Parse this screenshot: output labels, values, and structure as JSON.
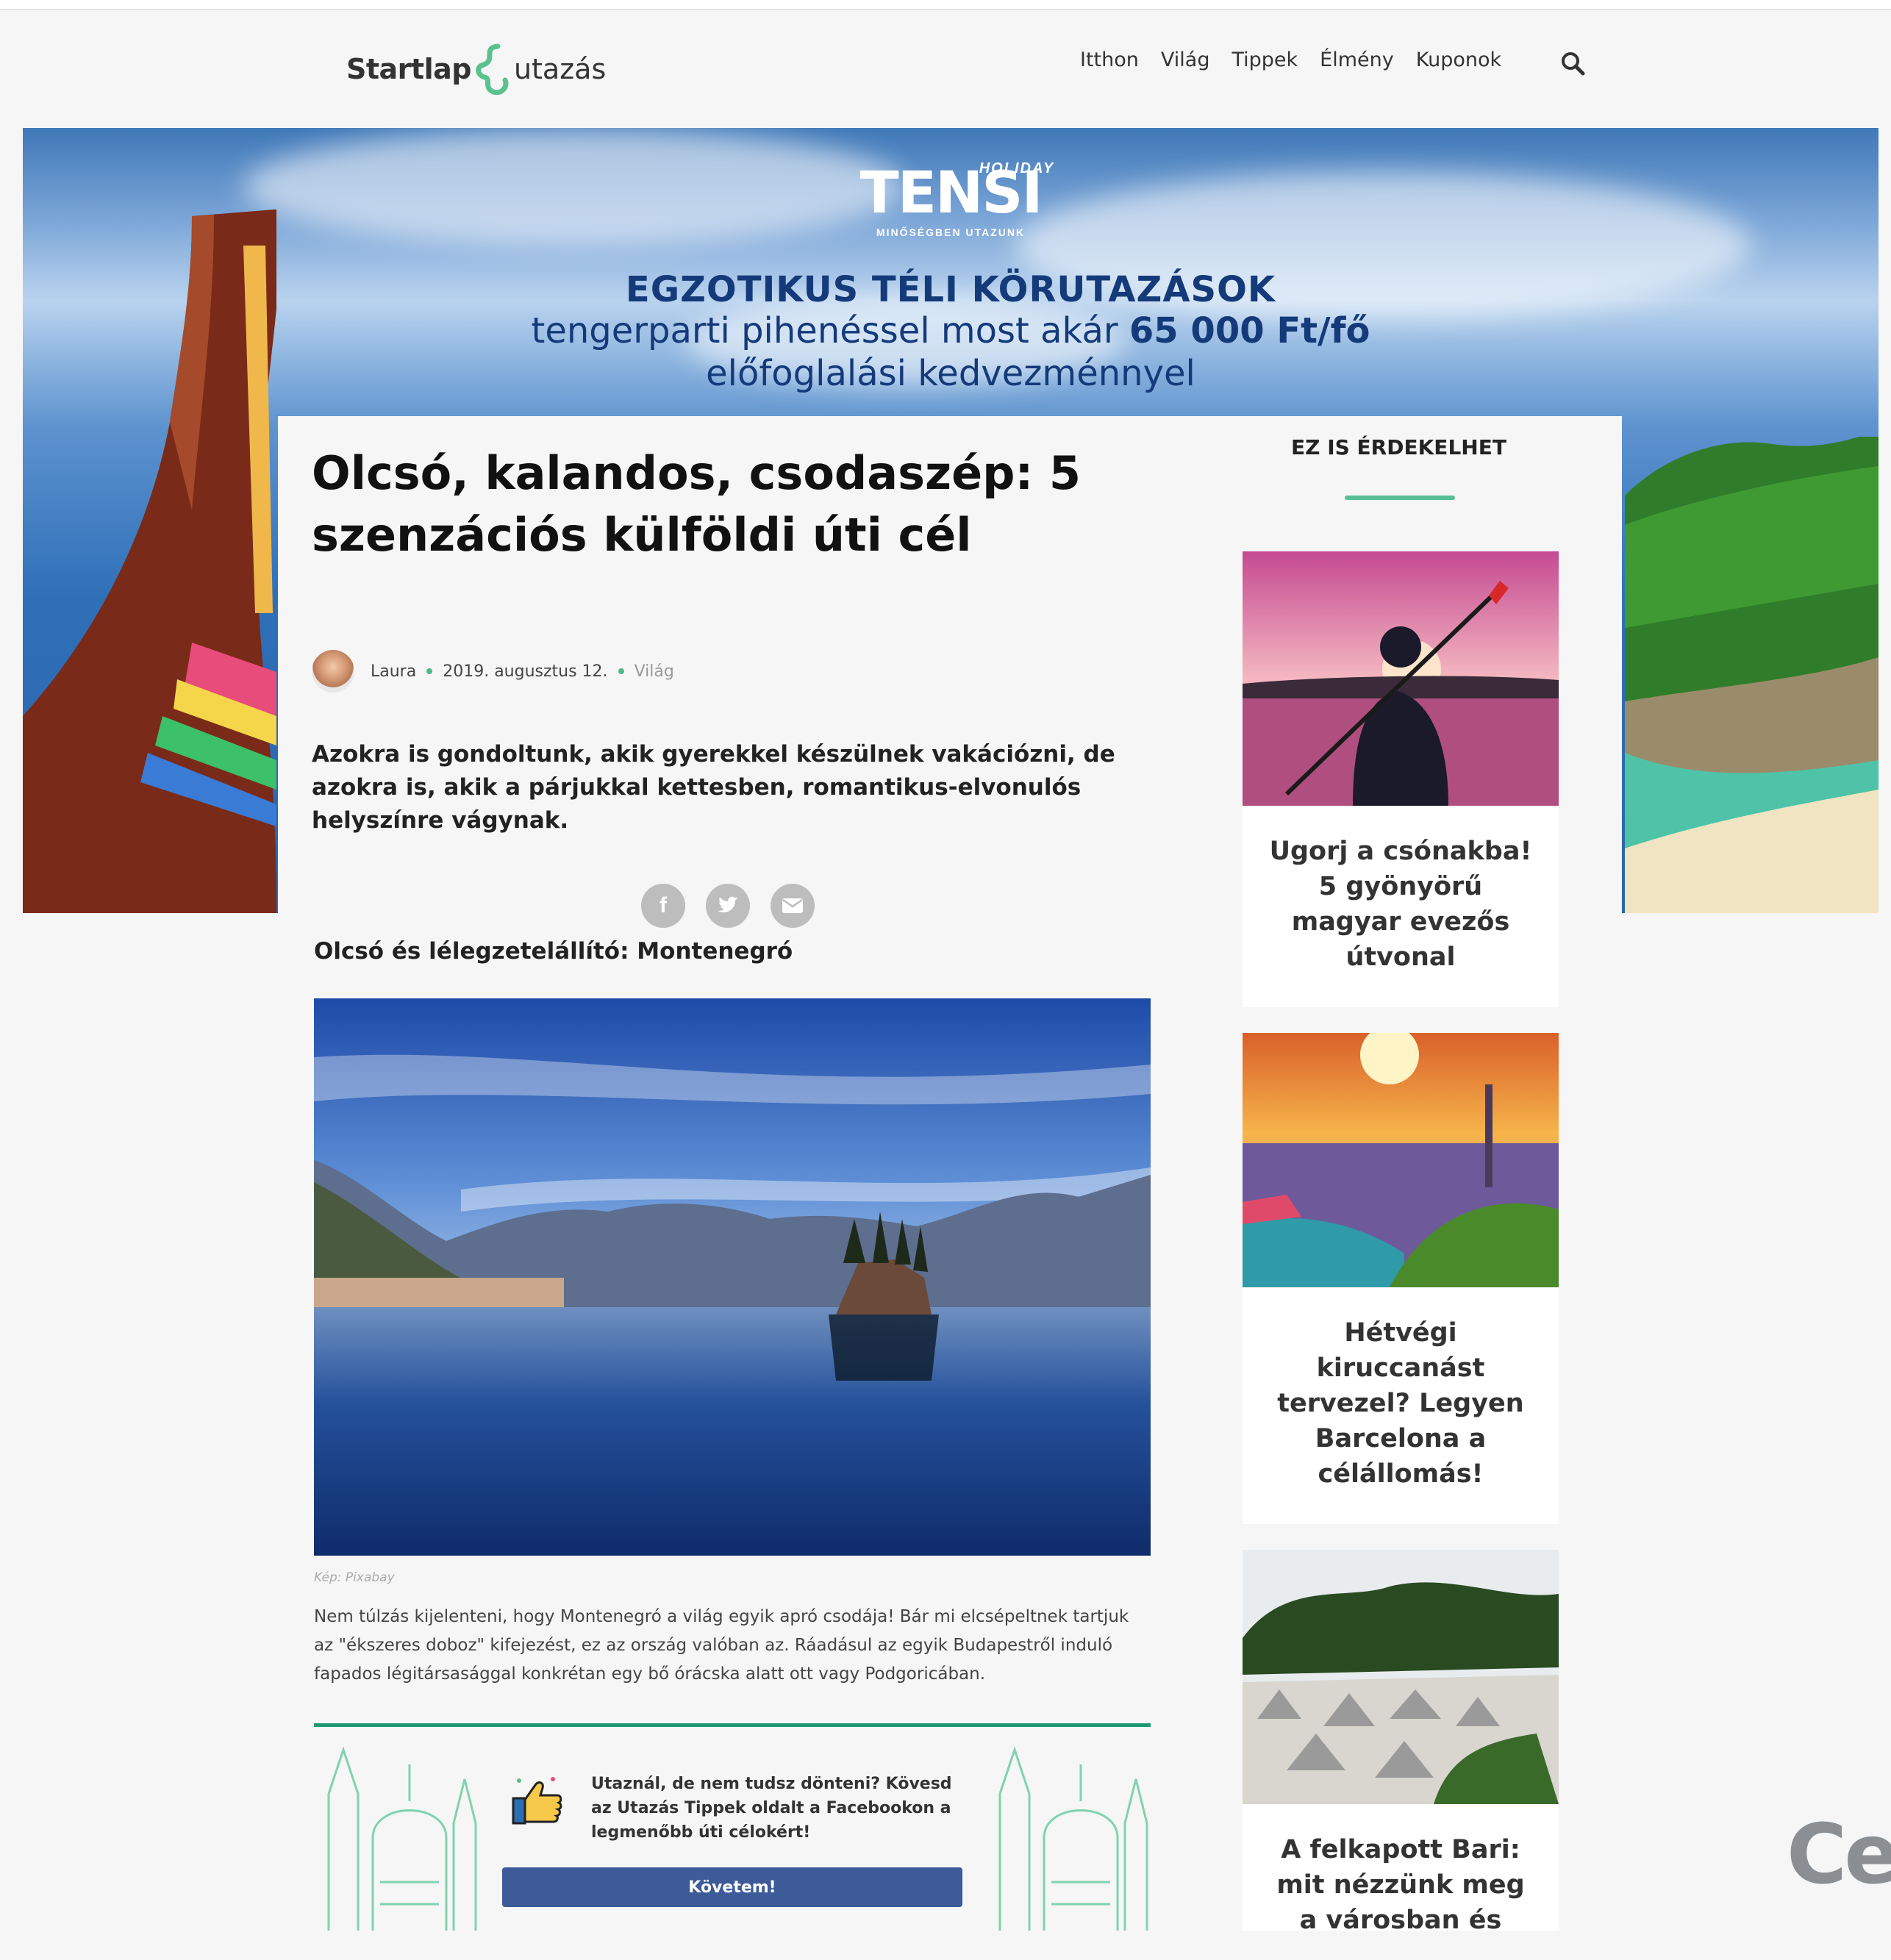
{
  "header": {
    "logo_part1": "Startlap",
    "logo_part2": "utazás",
    "nav": [
      "Itthon",
      "Világ",
      "Tippek",
      "Élmény",
      "Kuponok"
    ]
  },
  "banner": {
    "brand_small": "HOLIDAY",
    "brand": "TENSI",
    "brand_tagline": "MINŐSÉGBEN UTAZUNK",
    "headline": "EGZOTIKUS TÉLI KÖRUTAZÁSOK",
    "line2_prefix": "tengerparti pihenéssel most akár ",
    "line2_price": "65 000 Ft/fő",
    "line3": "előfoglalási kedvezménnyel"
  },
  "article": {
    "title": "Olcsó, kalandos, csodaszép: 5 szenzációs külföldi úti cél",
    "author": "Laura",
    "date": "2019. augusztus 12.",
    "category": "Világ",
    "lead": "Azokra is gondoltunk, akik gyerekkel készülnek vakációzni, de azokra is, akik a párjukkal kettesben, romantikus-elvonulós helyszínre vágynak.",
    "section_title": "Olcsó és lélegzetelállító: Montenegró",
    "image_caption": "Kép: Pixabay",
    "body": "Nem túlzás kijelenteni, hogy Montenegró a világ egyik apró csodája! Bár mi elcsépeltnek tartjuk az \"ékszeres doboz\" kifejezést, ez az ország valóban az. Ráadásul az egyik Budapestről induló fapados légitársasággal konkrétan egy bő órácska alatt ott vagy Podgoricában."
  },
  "promo": {
    "text": "Utaznál, de nem tudsz dönteni? Kövesd az Utazás Tippek oldalt a Facebookon a legmenőbb úti célokért!",
    "button": "Követem!"
  },
  "sidebar": {
    "title": "EZ IS ÉRDEKELHET",
    "cards": [
      {
        "title": "Ugorj a csónakba! 5 gyönyörű magyar evezős útvonal"
      },
      {
        "title": "Hétvégi kiruccanást tervezel? Legyen Barcelona a célállomás!"
      },
      {
        "title": "A felkapott Bari: mit nézzünk meg a városban és"
      }
    ]
  },
  "corner_text": "Ce",
  "colors": {
    "accent": "#57bf93",
    "dark_accent": "#1e9a73",
    "facebook": "#3d5a99",
    "banner_text": "#143a7a"
  }
}
